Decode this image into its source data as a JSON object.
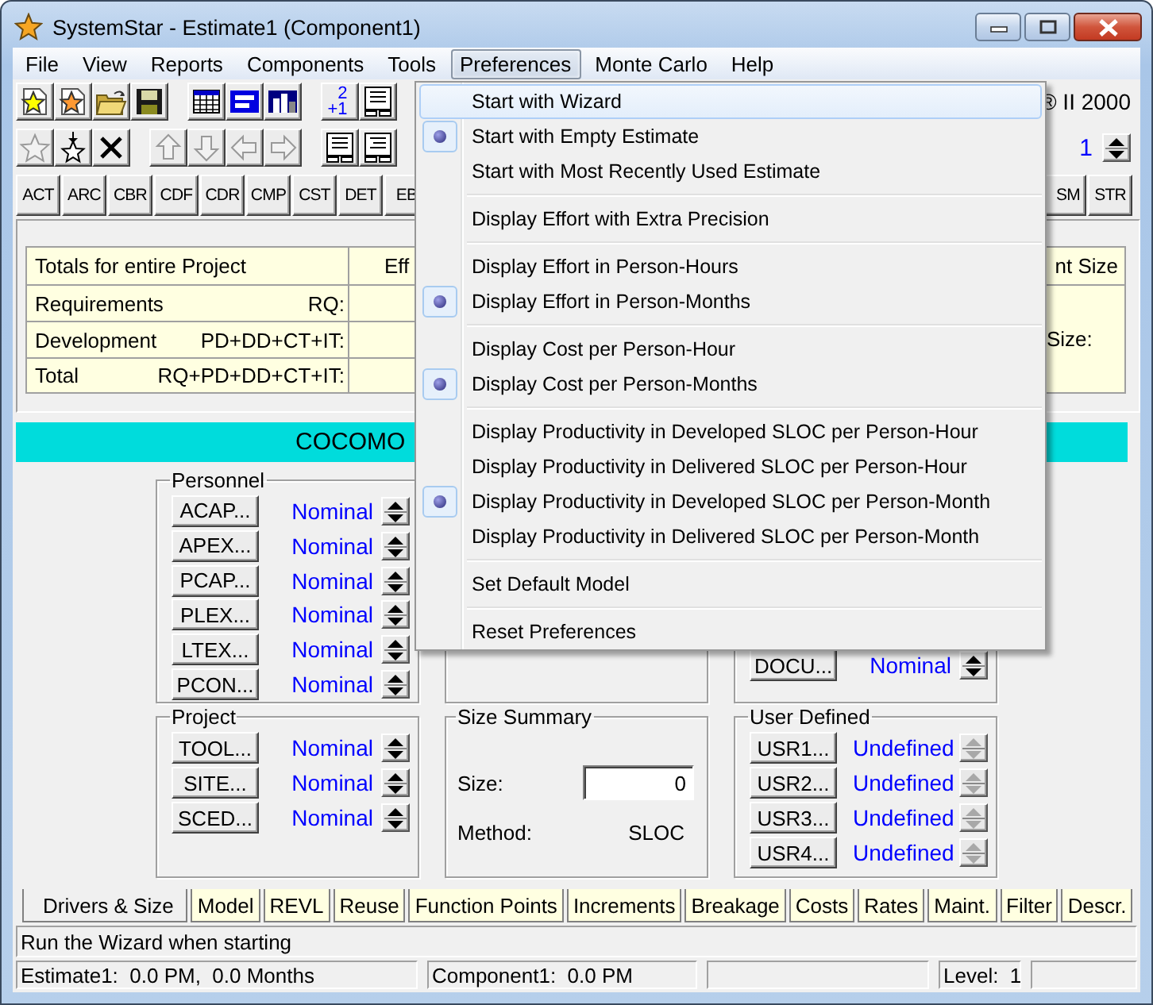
{
  "window": {
    "title": "SystemStar - Estimate1 (Component1)"
  },
  "menu_bar": [
    {
      "label": "File",
      "selected": false
    },
    {
      "label": "View",
      "selected": false
    },
    {
      "label": "Reports",
      "selected": false
    },
    {
      "label": "Components",
      "selected": false
    },
    {
      "label": "Tools",
      "selected": false
    },
    {
      "label": "Preferences",
      "selected": true
    },
    {
      "label": "Monte Carlo",
      "selected": false
    },
    {
      "label": "Help",
      "selected": false
    }
  ],
  "toolbar_1": [
    [
      {
        "kind": "icon"
      },
      {
        "kind": "icon"
      },
      {
        "kind": "icon"
      },
      {
        "kind": "icon"
      }
    ],
    [
      {
        "kind": "icon"
      },
      {
        "kind": "icon"
      },
      {
        "kind": "icon"
      }
    ],
    [
      {
        "kind": "numbers",
        "lines": [
          "2",
          "+1"
        ]
      },
      {
        "kind": "icon"
      }
    ]
  ],
  "toolbar_2": [
    [
      {
        "kind": "icon",
        "disabled": true
      },
      {
        "kind": "icon",
        "disabled": false
      },
      {
        "kind": "icon",
        "disabled": false
      }
    ],
    [
      {
        "kind": "icon",
        "disabled": true
      },
      {
        "kind": "icon",
        "disabled": true
      },
      {
        "kind": "icon",
        "disabled": true
      },
      {
        "kind": "icon",
        "disabled": true
      }
    ],
    [
      {
        "kind": "icon",
        "disabled": false
      },
      {
        "kind": "icon",
        "disabled": false
      }
    ]
  ],
  "version_label": "® II 2000",
  "component_counter": "1",
  "module_buttons": [
    "ACT",
    "ARC",
    "CBR",
    "CDF",
    "CDR",
    "CMP",
    "CST",
    "DET",
    "EB"
  ],
  "module_buttons_right": [
    "SM",
    "STR"
  ],
  "totals_table": {
    "columns": [
      "Totals for entire Project",
      "Eff",
      "nt Size"
    ],
    "rows": [
      {
        "phase": "Requirements",
        "formula": "RQ:"
      },
      {
        "phase": "Development",
        "formula": "PD+DD+CT+IT:"
      },
      {
        "phase": "Total",
        "formula": "RQ+PD+DD+CT+IT:"
      }
    ],
    "size_label": "Size:"
  },
  "model_banner": "COCOMO",
  "groups": [
    {
      "kind": "drivers",
      "title": "Personnel",
      "rows": [
        {
          "name": "ACAP...",
          "value": "Nominal",
          "disabled": false
        },
        {
          "name": "APEX...",
          "value": "Nominal",
          "disabled": false
        },
        {
          "name": "PCAP...",
          "value": "Nominal",
          "disabled": false
        },
        {
          "name": "PLEX...",
          "value": "Nominal",
          "disabled": false
        },
        {
          "name": "LTEX...",
          "value": "Nominal",
          "disabled": false
        },
        {
          "name": "PCON...",
          "value": "Nominal",
          "disabled": false
        }
      ]
    },
    {
      "kind": "drivers"
    },
    {
      "kind": "drivers",
      "rows": [
        {
          "name": "DOCU...",
          "value": "Nominal",
          "disabled": false
        }
      ]
    },
    {
      "kind": "drivers",
      "title": "Project",
      "rows": [
        {
          "name": "TOOL...",
          "value": "Nominal",
          "disabled": false
        },
        {
          "name": "SITE...",
          "value": "Nominal",
          "disabled": false
        },
        {
          "name": "SCED...",
          "value": "Nominal",
          "disabled": false
        }
      ]
    },
    {
      "kind": "size",
      "title": "Size Summary",
      "size_label": "Size:",
      "size_value": "0",
      "method_label": "Method:",
      "method_value": "SLOC"
    },
    {
      "kind": "drivers",
      "title": "User Defined",
      "rows": [
        {
          "name": "USR1...",
          "value": "Undefined",
          "disabled": true
        },
        {
          "name": "USR2...",
          "value": "Undefined",
          "disabled": true
        },
        {
          "name": "USR3...",
          "value": "Undefined",
          "disabled": true
        },
        {
          "name": "USR4...",
          "value": "Undefined",
          "disabled": true
        }
      ]
    }
  ],
  "tabs": [
    {
      "label": "Drivers & Size",
      "selected": true
    },
    {
      "label": "Model",
      "selected": false
    },
    {
      "label": "REVL",
      "selected": false
    },
    {
      "label": "Reuse",
      "selected": false
    },
    {
      "label": "Function Points",
      "selected": false
    },
    {
      "label": "Increments",
      "selected": false
    },
    {
      "label": "Breakage",
      "selected": false
    },
    {
      "label": "Costs",
      "selected": false
    },
    {
      "label": "Rates",
      "selected": false
    },
    {
      "label": "Maint.",
      "selected": false
    },
    {
      "label": "Filter",
      "selected": false
    },
    {
      "label": "Descr.",
      "selected": false
    }
  ],
  "status_message": "Run the Wizard when starting",
  "status_bar": [
    "Estimate1:  0.0 PM,  0.0 Months",
    "Component1:  0.0 PM",
    "Level:  1"
  ],
  "preferences_menu": [
    {
      "kind": "item",
      "label": "Start with Wizard",
      "selected": true,
      "checked": false
    },
    {
      "kind": "item",
      "label": "Start with Empty Estimate",
      "selected": false,
      "checked": true
    },
    {
      "kind": "item",
      "label": "Start with Most Recently Used Estimate",
      "selected": false,
      "checked": false
    },
    {
      "kind": "separator"
    },
    {
      "kind": "item",
      "label": "Display Effort with Extra Precision",
      "selected": false,
      "checked": false
    },
    {
      "kind": "separator"
    },
    {
      "kind": "item",
      "label": "Display Effort in Person-Hours",
      "selected": false,
      "checked": false
    },
    {
      "kind": "item",
      "label": "Display Effort in Person-Months",
      "selected": false,
      "checked": true
    },
    {
      "kind": "separator"
    },
    {
      "kind": "item",
      "label": "Display Cost per Person-Hour",
      "selected": false,
      "checked": false
    },
    {
      "kind": "item",
      "label": "Display Cost per Person-Months",
      "selected": false,
      "checked": true
    },
    {
      "kind": "separator"
    },
    {
      "kind": "item",
      "label": "Display Productivity in Developed SLOC per Person-Hour",
      "selected": false,
      "checked": false
    },
    {
      "kind": "item",
      "label": "Display Productivity in Delivered SLOC per Person-Hour",
      "selected": false,
      "checked": false
    },
    {
      "kind": "item",
      "label": "Display Productivity in Developed SLOC per Person-Month",
      "selected": false,
      "checked": true
    },
    {
      "kind": "item",
      "label": "Display Productivity in Delivered SLOC per Person-Month",
      "selected": false,
      "checked": false
    },
    {
      "kind": "separator"
    },
    {
      "kind": "item",
      "label": "Set Default Model",
      "selected": false,
      "checked": false
    },
    {
      "kind": "separator"
    },
    {
      "kind": "item",
      "label": "Reset Preferences",
      "selected": false,
      "checked": false
    }
  ]
}
